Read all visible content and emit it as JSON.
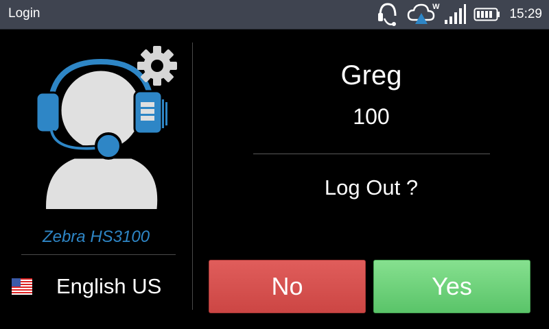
{
  "statusbar": {
    "title": "Login",
    "time": "15:29",
    "wifi_badge": "W",
    "icons": [
      "headset-connection-icon",
      "cloud-sync-icon",
      "signal-strength-icon",
      "battery-icon"
    ]
  },
  "profile": {
    "device_name": "Zebra HS3100",
    "language": "English US",
    "icons": [
      "headset-avatar-icon",
      "gear-icon",
      "us-flag-icon"
    ]
  },
  "dialog": {
    "user_name": "Greg",
    "user_id": "100",
    "question": "Log Out ?",
    "no_label": "No",
    "yes_label": "Yes"
  },
  "colors": {
    "statusbar_bg": "#3f4450",
    "accent_blue": "#2e86c6",
    "no_button": "#d9504e",
    "yes_button": "#6fd37b"
  }
}
